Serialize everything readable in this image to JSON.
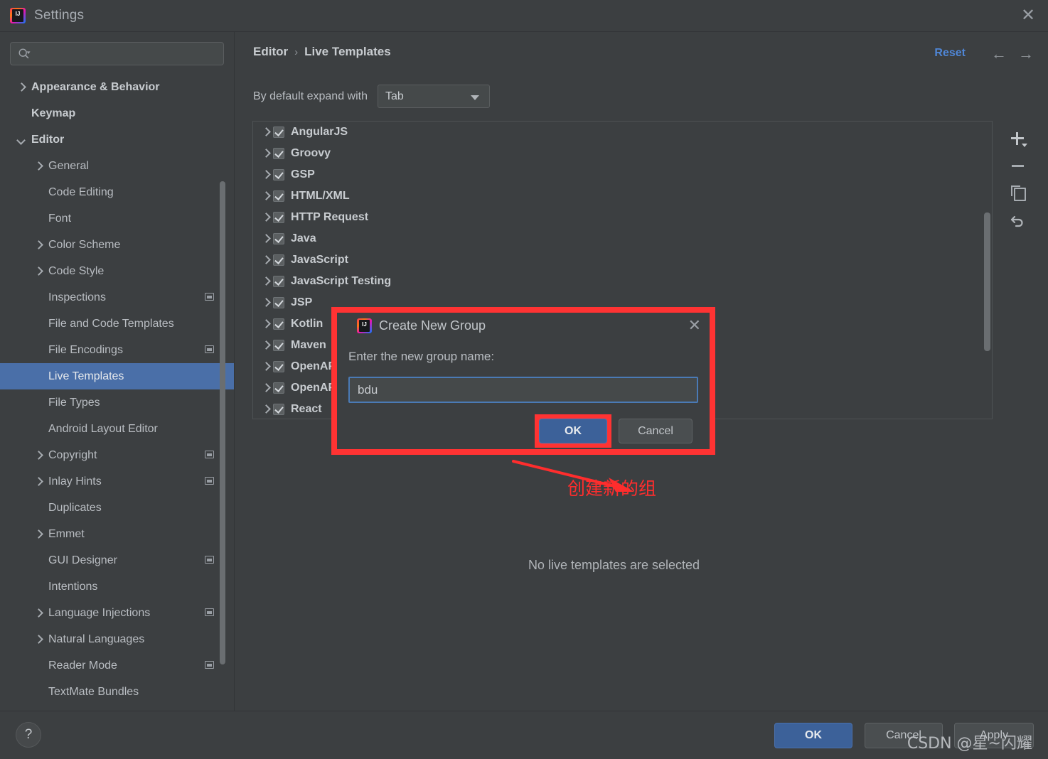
{
  "window": {
    "title": "Settings",
    "close_label": "✕",
    "logo_text": "IJ"
  },
  "sidebar": {
    "search": {
      "value": "",
      "placeholder": "",
      "icon": "search-icon"
    },
    "items": [
      {
        "label": "Appearance & Behavior",
        "indent": 0,
        "chevron": "right",
        "bold": true,
        "badge": false,
        "selected": false
      },
      {
        "label": "Keymap",
        "indent": 0,
        "chevron": "none",
        "bold": true,
        "badge": false,
        "selected": false
      },
      {
        "label": "Editor",
        "indent": 0,
        "chevron": "down",
        "bold": true,
        "badge": false,
        "selected": false
      },
      {
        "label": "General",
        "indent": 1,
        "chevron": "right",
        "bold": false,
        "badge": false,
        "selected": false
      },
      {
        "label": "Code Editing",
        "indent": 1,
        "chevron": "none",
        "bold": false,
        "badge": false,
        "selected": false
      },
      {
        "label": "Font",
        "indent": 1,
        "chevron": "none",
        "bold": false,
        "badge": false,
        "selected": false
      },
      {
        "label": "Color Scheme",
        "indent": 1,
        "chevron": "right",
        "bold": false,
        "badge": false,
        "selected": false
      },
      {
        "label": "Code Style",
        "indent": 1,
        "chevron": "right",
        "bold": false,
        "badge": false,
        "selected": false
      },
      {
        "label": "Inspections",
        "indent": 1,
        "chevron": "none",
        "bold": false,
        "badge": true,
        "selected": false
      },
      {
        "label": "File and Code Templates",
        "indent": 1,
        "chevron": "none",
        "bold": false,
        "badge": false,
        "selected": false
      },
      {
        "label": "File Encodings",
        "indent": 1,
        "chevron": "none",
        "bold": false,
        "badge": true,
        "selected": false
      },
      {
        "label": "Live Templates",
        "indent": 1,
        "chevron": "none",
        "bold": false,
        "badge": false,
        "selected": true
      },
      {
        "label": "File Types",
        "indent": 1,
        "chevron": "none",
        "bold": false,
        "badge": false,
        "selected": false
      },
      {
        "label": "Android Layout Editor",
        "indent": 1,
        "chevron": "none",
        "bold": false,
        "badge": false,
        "selected": false
      },
      {
        "label": "Copyright",
        "indent": 1,
        "chevron": "right",
        "bold": false,
        "badge": true,
        "selected": false
      },
      {
        "label": "Inlay Hints",
        "indent": 1,
        "chevron": "right",
        "bold": false,
        "badge": true,
        "selected": false
      },
      {
        "label": "Duplicates",
        "indent": 1,
        "chevron": "none",
        "bold": false,
        "badge": false,
        "selected": false
      },
      {
        "label": "Emmet",
        "indent": 1,
        "chevron": "right",
        "bold": false,
        "badge": false,
        "selected": false
      },
      {
        "label": "GUI Designer",
        "indent": 1,
        "chevron": "none",
        "bold": false,
        "badge": true,
        "selected": false
      },
      {
        "label": "Intentions",
        "indent": 1,
        "chevron": "none",
        "bold": false,
        "badge": false,
        "selected": false
      },
      {
        "label": "Language Injections",
        "indent": 1,
        "chevron": "right",
        "bold": false,
        "badge": true,
        "selected": false
      },
      {
        "label": "Natural Languages",
        "indent": 1,
        "chevron": "right",
        "bold": false,
        "badge": false,
        "selected": false
      },
      {
        "label": "Reader Mode",
        "indent": 1,
        "chevron": "none",
        "bold": false,
        "badge": true,
        "selected": false
      },
      {
        "label": "TextMate Bundles",
        "indent": 1,
        "chevron": "none",
        "bold": false,
        "badge": false,
        "selected": false
      }
    ]
  },
  "main": {
    "breadcrumb": {
      "parent": "Editor",
      "separator": "›",
      "current": "Live Templates"
    },
    "reset_label": "Reset",
    "nav_back": "←",
    "nav_forward": "→",
    "expand_label": "By default expand with",
    "expand_value": "Tab",
    "empty_message": "No live templates are selected",
    "groups": [
      {
        "label": "AngularJS",
        "checked": true
      },
      {
        "label": "Groovy",
        "checked": true
      },
      {
        "label": "GSP",
        "checked": true
      },
      {
        "label": "HTML/XML",
        "checked": true
      },
      {
        "label": "HTTP Request",
        "checked": true
      },
      {
        "label": "Java",
        "checked": true
      },
      {
        "label": "JavaScript",
        "checked": true
      },
      {
        "label": "JavaScript Testing",
        "checked": true
      },
      {
        "label": "JSP",
        "checked": true
      },
      {
        "label": "Kotlin",
        "checked": true
      },
      {
        "label": "Maven",
        "checked": true
      },
      {
        "label": "OpenAPI",
        "checked": true
      },
      {
        "label": "OpenAPI Schema",
        "checked": true
      },
      {
        "label": "React",
        "checked": true
      }
    ],
    "toolbar": {
      "add": "add-icon",
      "remove": "remove-icon",
      "duplicate": "duplicate-icon",
      "revert": "revert-icon"
    }
  },
  "dialog": {
    "title": "Create New Group",
    "close_label": "✕",
    "prompt": "Enter the new group name:",
    "input_value": "bdu",
    "input_placeholder": "",
    "ok_label": "OK",
    "cancel_label": "Cancel"
  },
  "annotation": {
    "text": "创建新的组",
    "color": "#ff2d2d"
  },
  "bottom": {
    "help_label": "?",
    "ok_label": "OK",
    "cancel_label": "Cancel",
    "apply_label": "Apply",
    "watermark": "CSDN @星~闪耀"
  },
  "colors": {
    "accent_blue": "#4f86d6",
    "selection_blue": "#4a6fa8",
    "primary_button": "#3c6199",
    "annotation_red": "#ff3333",
    "window_bg": "#3c3f41"
  }
}
